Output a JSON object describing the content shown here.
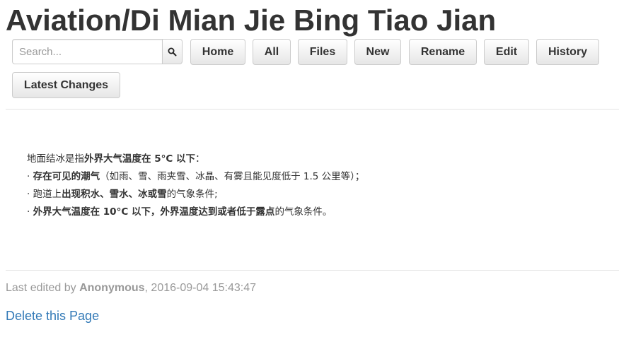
{
  "page": {
    "title": "Aviation/Di Mian Jie Bing Tiao Jian"
  },
  "toolbar": {
    "search_placeholder": "Search...",
    "search_icon": "magnifier-icon",
    "buttons": {
      "home": "Home",
      "all": "All",
      "files": "Files",
      "new": "New",
      "rename": "Rename",
      "edit": "Edit",
      "history": "History",
      "latest_changes": "Latest Changes"
    }
  },
  "content": {
    "intro": {
      "a": "地面结冰是指",
      "b": "外界大气温度在 5°C 以下",
      "c": "："
    },
    "items": [
      {
        "bullet": "· ",
        "pre": "",
        "bold": "存在可见的潮气",
        "post": "（如雨、雪、雨夹雪、冰晶、有雾且能见度低于 1.5 公里等）；"
      },
      {
        "bullet": "· ",
        "pre": "跑道上",
        "bold": "出现积水、雪水、冰或雪",
        "post": "的气象条件;"
      },
      {
        "bullet": "· ",
        "pre": "",
        "bold": "外界大气温度在 10°C 以下，外界温度达到或者低于露点",
        "post": "的气象条件。"
      }
    ]
  },
  "footer": {
    "edited_prefix": "Last edited by ",
    "author": "Anonymous",
    "timestamp": ", 2016-09-04 15:43:47",
    "delete_link": "Delete this Page"
  },
  "colors": {
    "text": "#333333",
    "muted": "#999999",
    "link": "#337ab7",
    "border": "#cccccc"
  }
}
